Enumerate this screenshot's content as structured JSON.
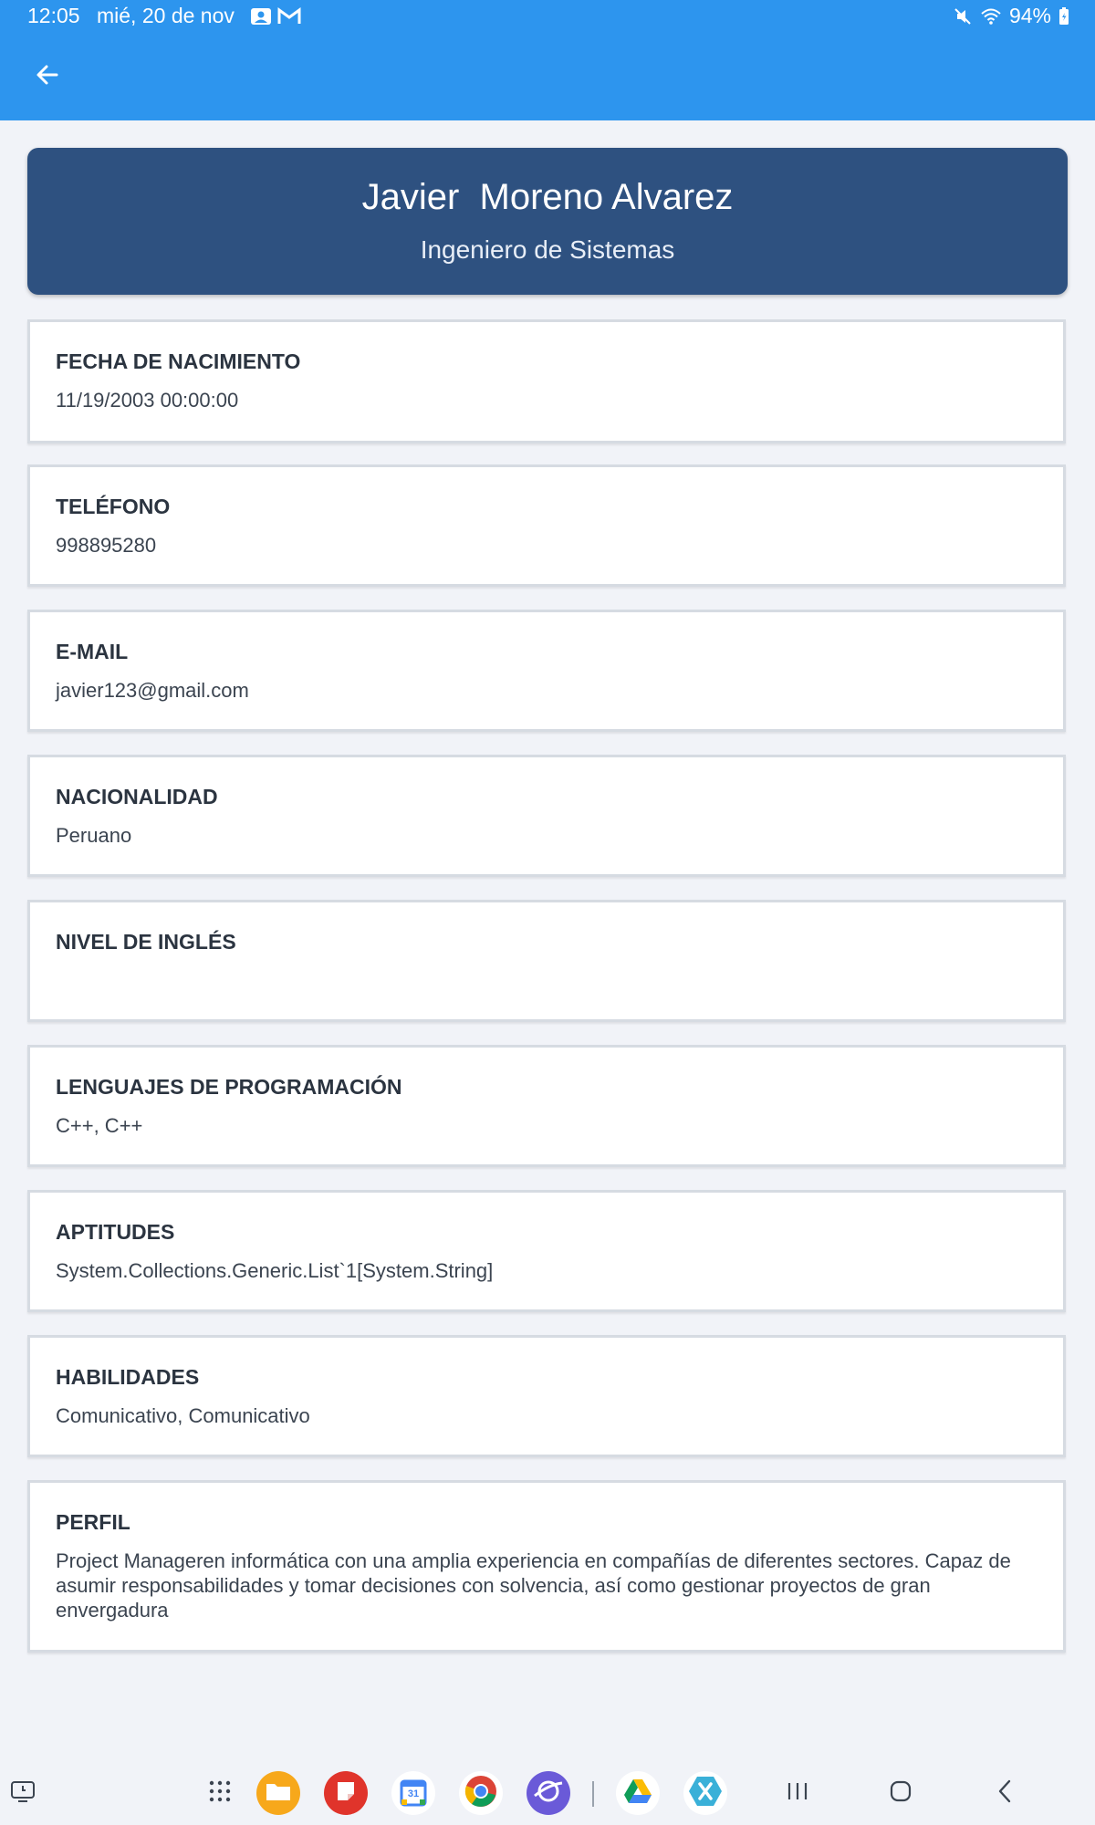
{
  "status_bar": {
    "time": "12:05",
    "date": "mié, 20 de nov",
    "battery": "94%"
  },
  "app_bar": {
    "back_icon": "arrow-left-icon"
  },
  "header": {
    "name": "Javier  Moreno Alvarez",
    "title": "Ingeniero de Sistemas"
  },
  "fields": [
    {
      "label": "FECHA DE NACIMIENTO",
      "value": "11/19/2003 00:00:00"
    },
    {
      "label": "TELÉFONO",
      "value": "998895280"
    },
    {
      "label": "E-MAIL",
      "value": "javier123@gmail.com"
    },
    {
      "label": "NACIONALIDAD",
      "value": "Peruano"
    },
    {
      "label": "NIVEL DE INGLÉS",
      "value": ""
    },
    {
      "label": "LENGUAJES DE PROGRAMACIÓN",
      "value": "C++, C++"
    },
    {
      "label": "APTITUDES",
      "value": "System.Collections.Generic.List`1[System.String]"
    },
    {
      "label": "HABILIDADES",
      "value": "Comunicativo, Comunicativo"
    },
    {
      "label": "PERFIL",
      "value": "Project Manageren informática con una amplia experiencia en compañías de diferentes sectores. Capaz de asumir responsabilidades y tomar decisiones con solvencia, así como gestionar proyectos de gran envergadura"
    }
  ],
  "taskbar": {
    "apps": [
      "app-drawer-icon",
      "files-icon",
      "notes-icon",
      "calendar-icon",
      "chrome-icon",
      "internet-icon",
      "drive-icon",
      "xamarin-icon"
    ],
    "calendar_day": "31"
  },
  "colors": {
    "app_bar": "#2d95ee",
    "header_card": "#2e5180",
    "background": "#f1f3f8"
  }
}
